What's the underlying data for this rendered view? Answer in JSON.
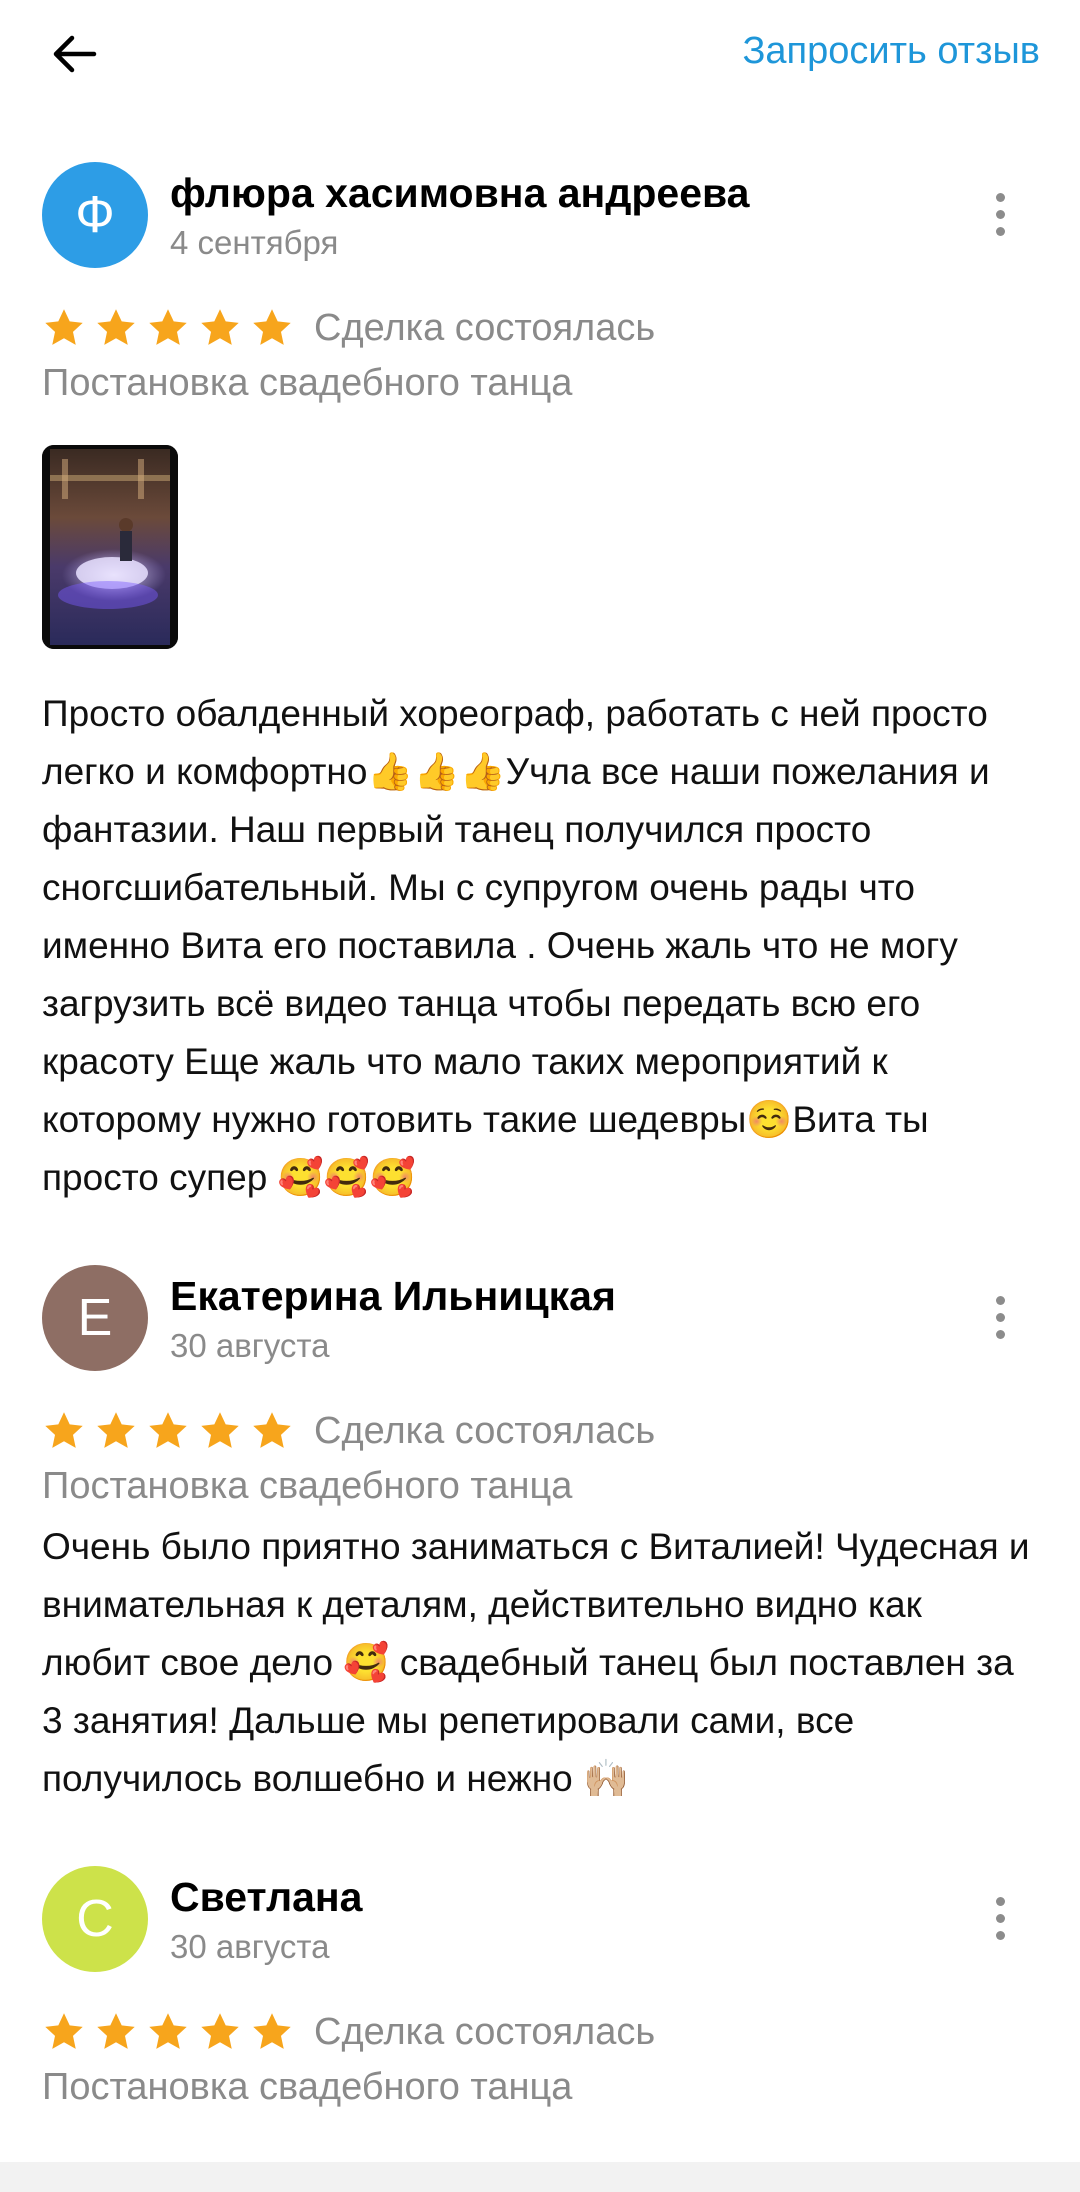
{
  "topbar": {
    "back_icon": "arrow-left-icon",
    "request_review_label": "Запросить отзыв",
    "accent_color": "#1e96d9"
  },
  "reviews": [
    {
      "avatar_letter": "Ф",
      "avatar_color": "#2d9de6",
      "author": "флюра хасимовна андреева",
      "date": "4 сентября",
      "rating": 5,
      "deal_status": "Сделка состоялась",
      "service": "Постановка свадебного танца",
      "has_photo": true,
      "text": "Просто обалденный хореограф, работать с ней просто легко и комфортно👍👍👍Учла все наши пожелания и фантазии. Наш первый танец получился просто сногсшибательный. Мы с супругом очень рады что именно Вита его поставила . Очень жаль что не могу загрузить всё видео танца чтобы передать всю его красоту Еще жаль что мало таких мероприятий к которому нужно готовить такие шедевры☺️Вита ты просто супер 🥰🥰🥰"
    },
    {
      "avatar_letter": "Е",
      "avatar_color": "#8e6e64",
      "author": "Екатерина Ильницкая",
      "date": "30 августа",
      "rating": 5,
      "deal_status": "Сделка состоялась",
      "service": "Постановка свадебного танца",
      "has_photo": false,
      "text": "Очень было приятно заниматься с Виталией! Чудесная и внимательная к деталям, действительно видно как любит свое дело 🥰 свадебный танец был поставлен за 3 занятия! Дальше мы репетировали сами, все получилось волшебно и нежно 🙌🏼"
    },
    {
      "avatar_letter": "С",
      "avatar_color": "#cde24a",
      "author": "Светлана",
      "date": "30 августа",
      "rating": 5,
      "deal_status": "Сделка состоялась",
      "service": "Постановка свадебного танца",
      "has_photo": false,
      "text": ""
    }
  ],
  "star_color": "#f7a51c"
}
